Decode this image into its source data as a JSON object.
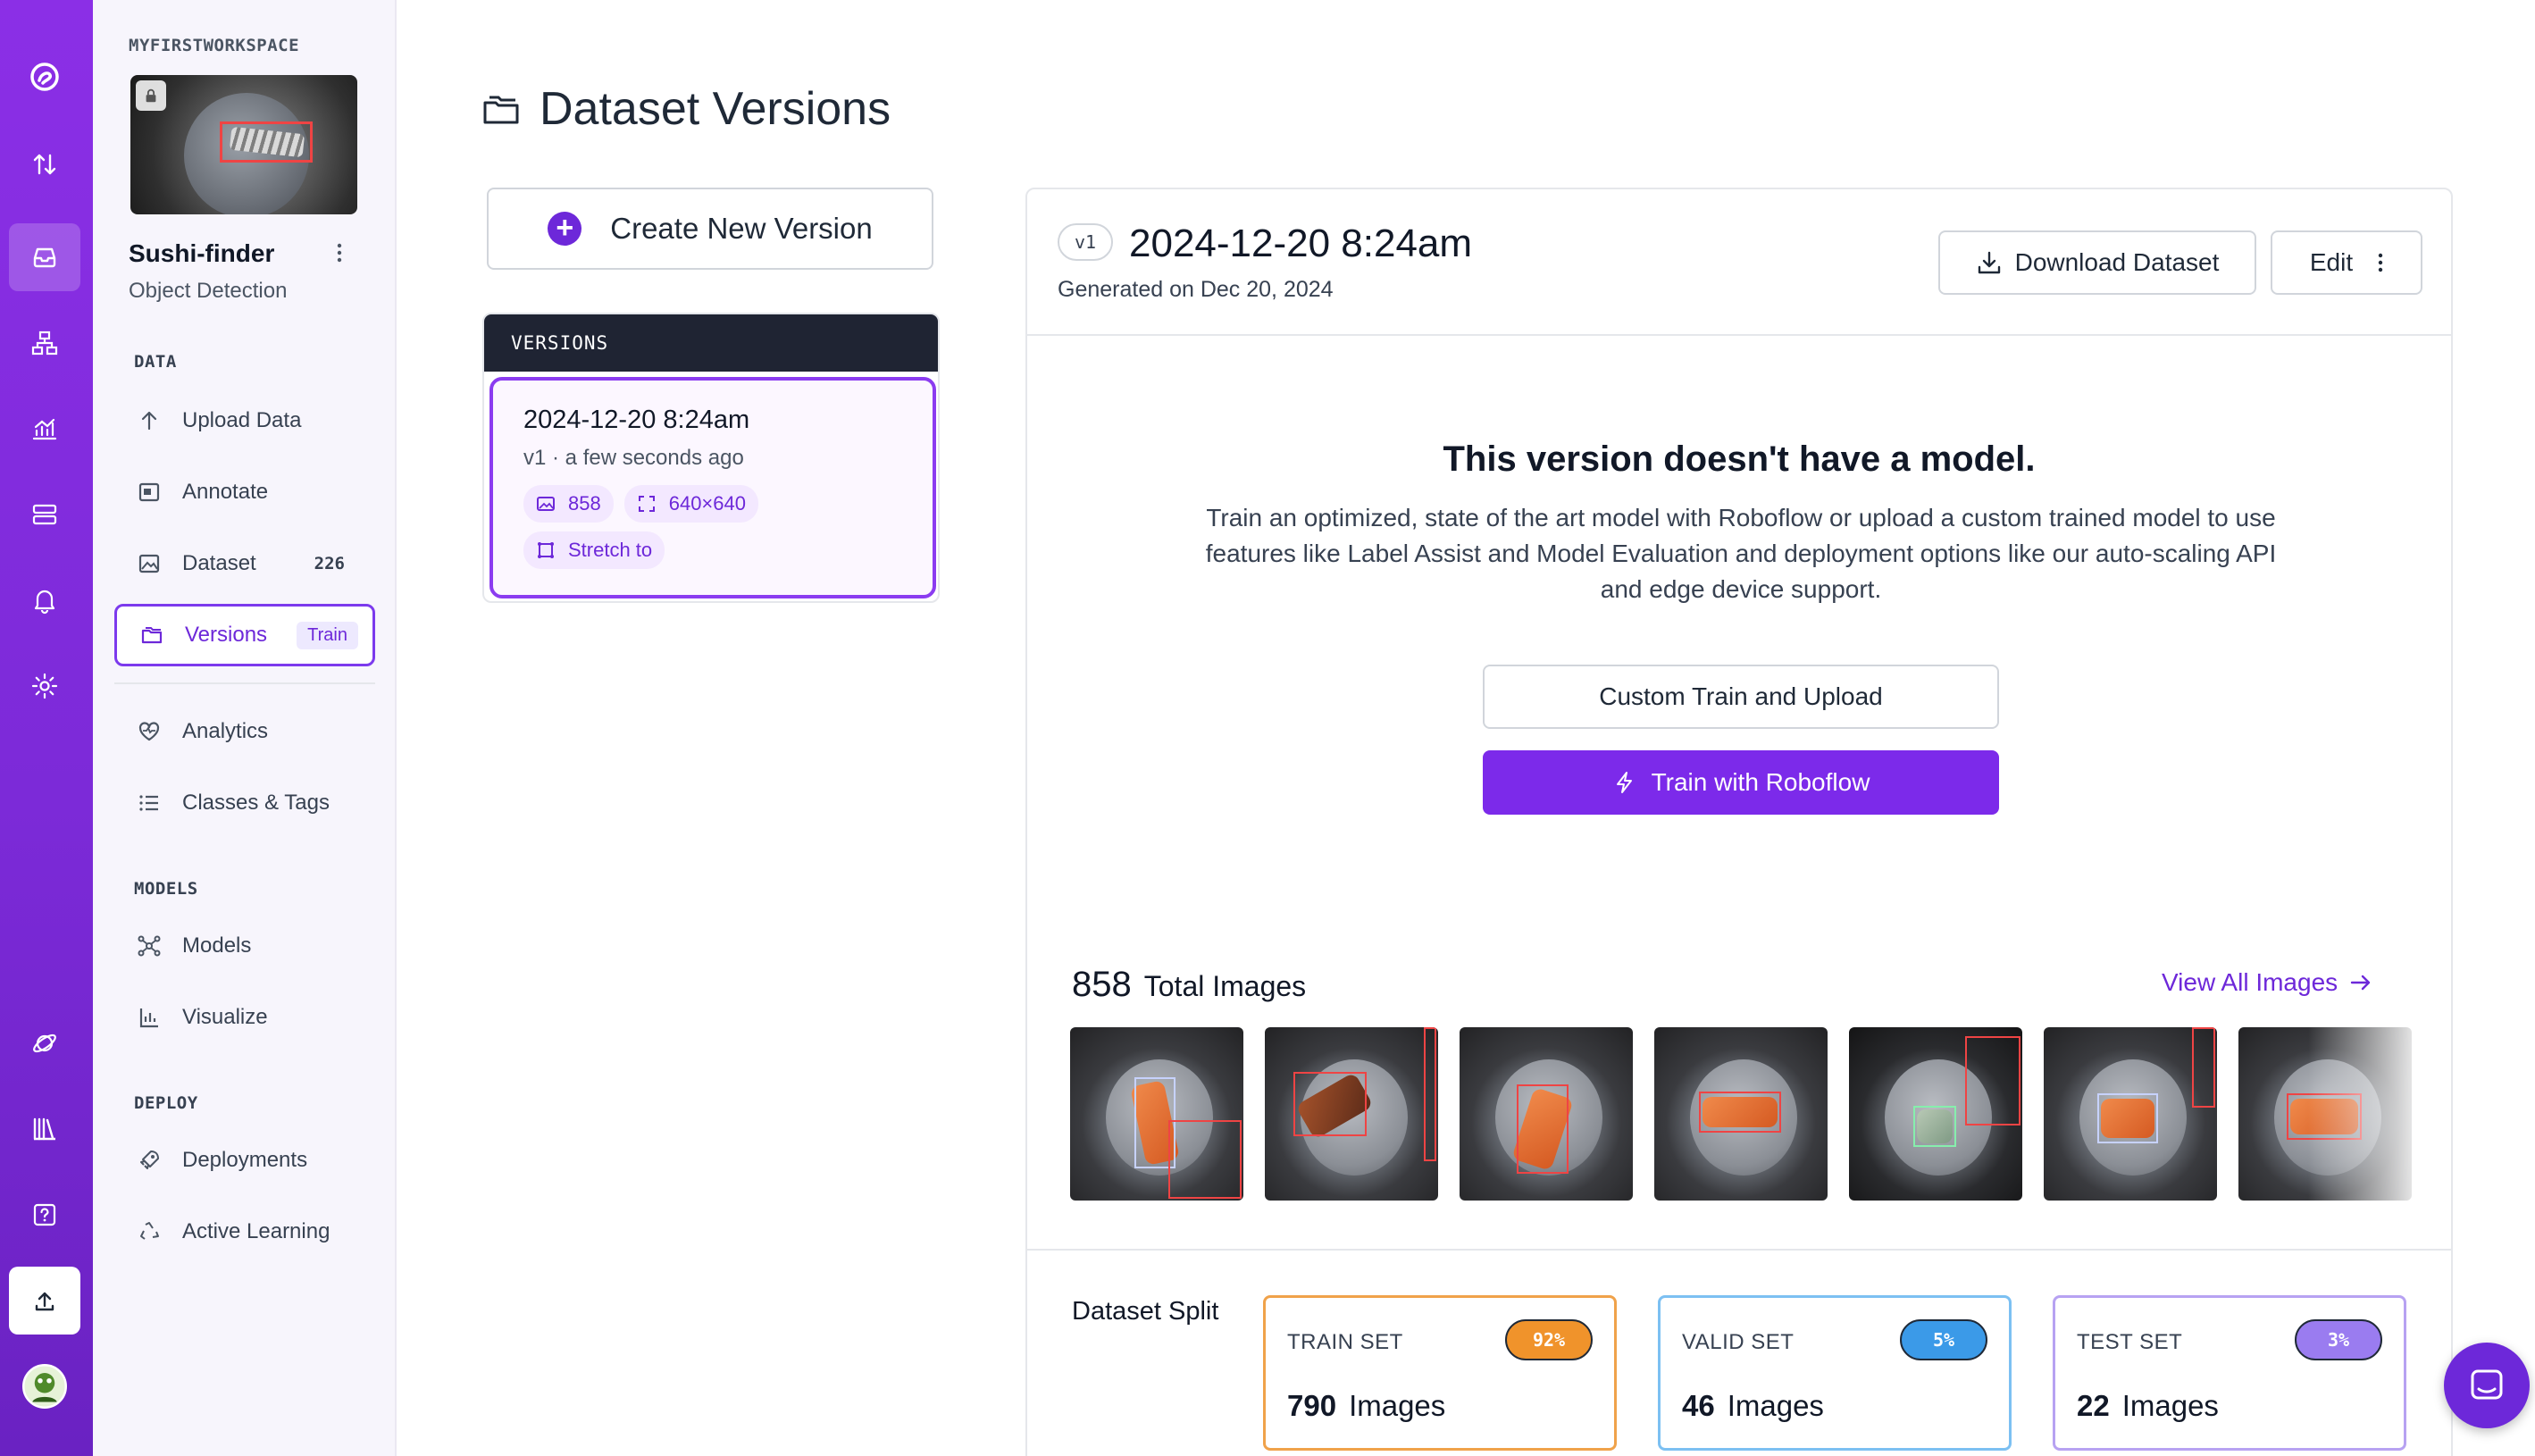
{
  "workspace": {
    "name": "MYFIRSTWORKSPACE"
  },
  "project": {
    "name": "Sushi-finder",
    "type": "Object Detection"
  },
  "sidebar": {
    "sections": {
      "data": "DATA",
      "models": "MODELS",
      "deploy": "DEPLOY"
    },
    "items": {
      "upload": {
        "label": "Upload Data",
        "icon": "arrow-up-icon"
      },
      "annotate": {
        "label": "Annotate",
        "icon": "annotate-icon"
      },
      "dataset": {
        "label": "Dataset",
        "icon": "image-icon",
        "count": "226"
      },
      "versions": {
        "label": "Versions",
        "icon": "folders-icon",
        "pill": "Train"
      },
      "analytics": {
        "label": "Analytics",
        "icon": "heart-pulse-icon"
      },
      "classes": {
        "label": "Classes & Tags",
        "icon": "list-icon"
      },
      "models": {
        "label": "Models",
        "icon": "network-icon"
      },
      "visualize": {
        "label": "Visualize",
        "icon": "chart-icon"
      },
      "deployments": {
        "label": "Deployments",
        "icon": "rocket-icon"
      },
      "active_learning": {
        "label": "Active Learning",
        "icon": "recycle-icon"
      }
    }
  },
  "page": {
    "title": "Dataset Versions",
    "create_label": "Create New Version"
  },
  "versions_list": {
    "header": "VERSIONS",
    "items": [
      {
        "title": "2024-12-20 8:24am",
        "subtitle": "v1 · a few seconds ago",
        "images": "858",
        "size": "640×640",
        "resize": "Stretch to"
      }
    ]
  },
  "version": {
    "badge": "v1",
    "title": "2024-12-20 8:24am",
    "generated": "Generated on Dec 20, 2024",
    "download_label": "Download Dataset",
    "edit_label": "Edit",
    "no_model_title": "This version doesn't have a model.",
    "no_model_text": "Train an optimized, state of the art model with Roboflow or upload a custom trained model to use features like Label Assist and Model Evaluation and deployment options like our auto-scaling API and edge device support.",
    "custom_train_label": "Custom Train and Upload",
    "train_label": "Train with Roboflow",
    "total_images": "858",
    "total_images_label": "Total Images",
    "view_all_label": "View All Images",
    "split_label": "Dataset Split",
    "splits": [
      {
        "name": "TRAIN SET",
        "percent": "92%",
        "count": "790",
        "unit": "Images",
        "color": "#f0932b",
        "border": "#f0a24a"
      },
      {
        "name": "VALID SET",
        "percent": "5%",
        "count": "46",
        "unit": "Images",
        "color": "#3b9ae8",
        "border": "#7cc0f2"
      },
      {
        "name": "TEST SET",
        "percent": "3%",
        "count": "22",
        "unit": "Images",
        "color": "#9a7cf0",
        "border": "#b7a2f2"
      }
    ]
  },
  "colors": {
    "brand": "#7c2aea",
    "rail": "#8b2fe6",
    "accent_text": "#6d28d9"
  }
}
